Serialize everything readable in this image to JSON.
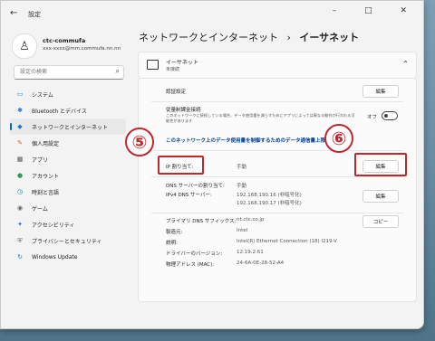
{
  "window": {
    "title": "設定",
    "controls": "– □ ✕"
  },
  "user": {
    "name": "ctc-commufa",
    "email": "xxx-xxxx@mm.commufa.nn.nn"
  },
  "search": {
    "placeholder": "設定の検索"
  },
  "sidebar": {
    "items": [
      {
        "label": "システム",
        "icon": "system-icon",
        "glyph": "▭",
        "color": "#1e73c9"
      },
      {
        "label": "Bluetooth とデバイス",
        "icon": "bluetooth-icon",
        "glyph": "✱",
        "color": "#1e73c9"
      },
      {
        "label": "ネットワークとインターネット",
        "icon": "network-icon",
        "glyph": "◆",
        "color": "#1e73c9",
        "active": true
      },
      {
        "label": "個人用設定",
        "icon": "personalize-icon",
        "glyph": "✎",
        "color": "#c0692b"
      },
      {
        "label": "アプリ",
        "icon": "apps-icon",
        "glyph": "▦",
        "color": "#555555"
      },
      {
        "label": "アカウント",
        "icon": "account-icon",
        "glyph": "●",
        "color": "#2e9a5a"
      },
      {
        "label": "時刻と言語",
        "icon": "time-language-icon",
        "glyph": "◷",
        "color": "#1e73c9"
      },
      {
        "label": "ゲーム",
        "icon": "gaming-icon",
        "glyph": "◉",
        "color": "#666666"
      },
      {
        "label": "アクセシビリティ",
        "icon": "accessibility-icon",
        "glyph": "✦",
        "color": "#1e73c9"
      },
      {
        "label": "プライバシーとセキュリティ",
        "icon": "privacy-icon",
        "glyph": "⛨",
        "color": "#666666"
      },
      {
        "label": "Windows Update",
        "icon": "windows-update-icon",
        "glyph": "↻",
        "color": "#1e73c9"
      }
    ]
  },
  "breadcrumb": {
    "parent": "ネットワークとインターネット",
    "sep": "›",
    "current": "イーサネット"
  },
  "ethernet": {
    "title": "イーサネット",
    "status": "未接続"
  },
  "auth": {
    "label": "認証設定",
    "button": "編集"
  },
  "metered": {
    "label": "従量制課金接続",
    "description": "このネットワークに接続している場合、データ使用量を減らすためにアプリによっては異なる動作が行われる可能性があります",
    "state": "オフ"
  },
  "data_limit_link": "このネットワーク上のデータ使用量を制御するためのデータ通信量上限を設定する",
  "ip": {
    "label": "IP 割り当て:",
    "value": "手動",
    "button": "編集"
  },
  "dns": {
    "label": "DNS サーバーの割り当て:",
    "value": "手動",
    "ipv4_label": "IPv4 DNS サーバー:",
    "ipv4_1": "192.168.190.16 (非暗号化)",
    "ipv4_2": "192.168.190.17 (非暗号化)",
    "button": "編集"
  },
  "props": {
    "copy_button": "コピー",
    "rows": [
      {
        "label": "プライマリ DNS サフィックス:",
        "value": "nt.ctc.co.jp"
      },
      {
        "label": "製造元:",
        "value": "Intel"
      },
      {
        "label": "説明:",
        "value": "Intel(R) Ethernet Connection (18) I219-V"
      },
      {
        "label": "ドライバーのバージョン:",
        "value": "12.19.2.61"
      },
      {
        "label": "物理アドレス (MAC):",
        "value": "24-6A-0E-28-52-A4"
      }
    ]
  },
  "annotations": {
    "five": "⑤",
    "six": "⑥"
  },
  "colors": {
    "accent": "#0067c0",
    "annotation_red": "#c1272d"
  }
}
